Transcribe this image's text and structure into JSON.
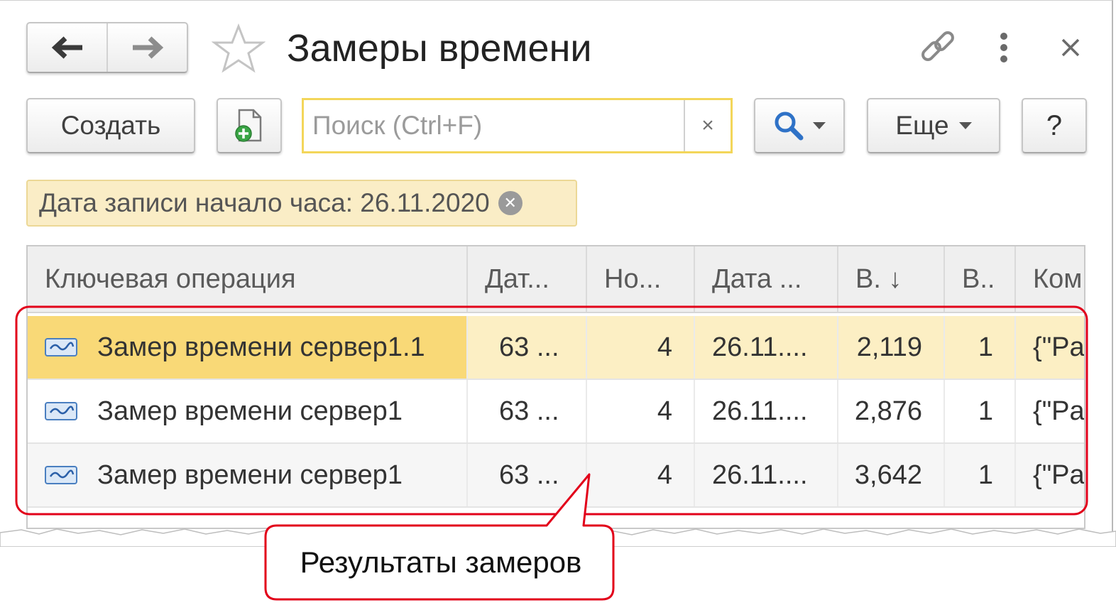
{
  "window": {
    "title": "Замеры времени",
    "back_icon": "arrow-left-icon",
    "forward_icon": "arrow-right-icon",
    "favorite_icon": "star-icon",
    "link_icon": "link-icon",
    "more_icon": "more-vertical-icon",
    "close_icon": "close-icon"
  },
  "toolbar": {
    "create_label": "Создать",
    "create_copy_icon": "add-document-icon",
    "search_placeholder": "Поиск (Ctrl+F)",
    "search_clear": "×",
    "search_icon": "search-icon",
    "more_label": "Еще",
    "help_label": "?"
  },
  "filter": {
    "label": "Дата записи начало часа: 26.11.2020",
    "remove_icon": "remove-circle-icon"
  },
  "table": {
    "columns": [
      "Ключевая операция",
      "Дат...",
      "Но...",
      "Дата ...",
      "В. ↓",
      "В..",
      "Ком"
    ],
    "rows": [
      {
        "operation": "Замер времени сервер1.1",
        "date": "63 ...",
        "num": "4",
        "date2": "26.11....",
        "value": "2,119",
        "v2": "1",
        "comment": "{\"Pa"
      },
      {
        "operation": "Замер времени сервер1",
        "date": "63 ...",
        "num": "4",
        "date2": "26.11....",
        "value": "2,876",
        "v2": "1",
        "comment": "{\"Pa"
      },
      {
        "operation": "Замер времени сервер1",
        "date": "63 ...",
        "num": "4",
        "date2": "26.11....",
        "value": "3,642",
        "v2": "1",
        "comment": "{\"Pa"
      }
    ],
    "selected_row": 0
  },
  "callout": {
    "text": "Результаты замеров",
    "color": "#e2001a"
  }
}
